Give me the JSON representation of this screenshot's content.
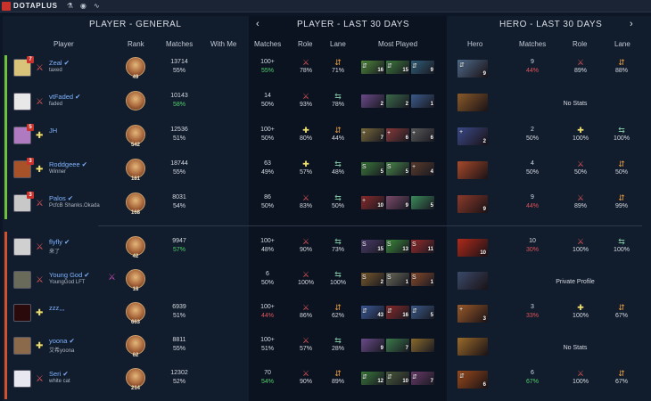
{
  "app": {
    "brand": "DOTAPLUS",
    "icons": [
      "flask-icon",
      "user-circle-icon",
      "waveform-icon"
    ]
  },
  "sections": {
    "general": "PLAYER - GENERAL",
    "last30": "PLAYER - LAST 30 DAYS",
    "hero30": "HERO - LAST 30 DAYS",
    "prev_arrow": "‹",
    "next_arrow": "›"
  },
  "headers": {
    "player": "Player",
    "rank": "Rank",
    "matches": "Matches",
    "with_me": "With Me",
    "l_matches": "Matches",
    "l_role": "Role",
    "l_lane": "Lane",
    "most_played": "Most Played",
    "hero": "Hero",
    "h_matches": "Matches",
    "h_role": "Role",
    "h_lane": "Lane"
  },
  "colors": {
    "radiant": "#6ec23b",
    "dire": "#d1502e",
    "positive": "#51d06b",
    "negative": "#e0555a"
  },
  "players": [
    {
      "name": "Zeal",
      "verified": true,
      "sub": "taxed",
      "badge": "7",
      "role_icon": "sword",
      "avatar_color": "#d9c37a",
      "rank_num": "49",
      "g_matches": "13714",
      "g_win": "55%",
      "g_win_color": "",
      "with_me": "",
      "l_matches": "100+",
      "l_win": "55%",
      "l_win_color": "green",
      "l_role_icon": "sword",
      "l_role_pct": "78%",
      "l_lane_icon": "swap",
      "l_lane_pct": "71%",
      "most": [
        {
          "role": "⇵",
          "count": "16",
          "color": "#4f8a3a"
        },
        {
          "role": "⇵",
          "count": "15",
          "color": "#3c7a3c"
        },
        {
          "role": "⇵",
          "count": "9",
          "color": "#2f5f7a"
        }
      ],
      "hero": {
        "role": "⇵",
        "count": "9",
        "color": "#4e6a8a"
      },
      "h_matches": "9",
      "h_win": "44%",
      "h_win_color": "red",
      "h_role_icon": "sword",
      "h_role_pct": "89%",
      "h_lane_icon": "swap",
      "h_lane_pct": "88%",
      "h_note": ""
    },
    {
      "name": "vtFaded",
      "verified": true,
      "sub": "faded",
      "badge": "",
      "role_icon": "sword",
      "avatar_color": "#e8e8e8",
      "rank_num": "",
      "g_matches": "10143",
      "g_win": "58%",
      "g_win_color": "green",
      "with_me": "",
      "l_matches": "14",
      "l_win": "50%",
      "l_win_color": "",
      "l_role_icon": "sword",
      "l_role_pct": "93%",
      "l_lane_icon": "lane",
      "l_lane_pct": "78%",
      "most": [
        {
          "role": "",
          "count": "2",
          "color": "#6a4a8a"
        },
        {
          "role": "",
          "count": "2",
          "color": "#3a6a4a"
        },
        {
          "role": "",
          "count": "1",
          "color": "#3a5a8a"
        }
      ],
      "hero": {
        "role": "",
        "count": "",
        "color": "#8a5a2a"
      },
      "h_matches": "",
      "h_win": "",
      "h_win_color": "",
      "h_role_icon": "",
      "h_role_pct": "",
      "h_lane_icon": "",
      "h_lane_pct": "",
      "h_note": "No Stats"
    },
    {
      "name": "JH",
      "verified": false,
      "sub": "",
      "badge": "5",
      "role_icon": "plus",
      "avatar_color": "#b07ac0",
      "rank_num": "542",
      "g_matches": "12536",
      "g_win": "51%",
      "g_win_color": "",
      "with_me": "",
      "l_matches": "100+",
      "l_win": "50%",
      "l_win_color": "",
      "l_role_icon": "plus",
      "l_role_pct": "80%",
      "l_lane_icon": "swap",
      "l_lane_pct": "44%",
      "most": [
        {
          "role": "+",
          "count": "7",
          "color": "#7a6a3a"
        },
        {
          "role": "+",
          "count": "6",
          "color": "#8a3a3a"
        },
        {
          "role": "+",
          "count": "6",
          "color": "#5a5a5a"
        }
      ],
      "hero": {
        "role": "+",
        "count": "2",
        "color": "#3a4a8a"
      },
      "h_matches": "2",
      "h_win": "50%",
      "h_win_color": "",
      "h_role_icon": "plus",
      "h_role_pct": "100%",
      "h_lane_icon": "lane",
      "h_lane_pct": "100%",
      "h_note": ""
    },
    {
      "name": "Roddgeee",
      "verified": true,
      "sub": "Winner",
      "badge": "3",
      "role_icon": "plus",
      "avatar_color": "#a8522a",
      "rank_num": "181",
      "g_matches": "18744",
      "g_win": "55%",
      "g_win_color": "",
      "with_me": "",
      "l_matches": "63",
      "l_win": "49%",
      "l_win_color": "",
      "l_role_icon": "plus",
      "l_role_pct": "57%",
      "l_lane_icon": "lane",
      "l_lane_pct": "48%",
      "most": [
        {
          "role": "S",
          "count": "5",
          "color": "#3a7a3a"
        },
        {
          "role": "S",
          "count": "5",
          "color": "#4a8a4a"
        },
        {
          "role": "+",
          "count": "4",
          "color": "#5a3a2a"
        }
      ],
      "hero": {
        "role": "",
        "count": "",
        "color": "#a84a2a"
      },
      "h_matches": "4",
      "h_win": "50%",
      "h_win_color": "",
      "h_role_icon": "sword",
      "h_role_pct": "50%",
      "h_lane_icon": "swap",
      "h_lane_pct": "50%",
      "h_note": ""
    },
    {
      "name": "Palos",
      "verified": true,
      "sub": "PcfcB Shanks.Okada",
      "badge": "3",
      "role_icon": "sword",
      "avatar_color": "#c8c8c8",
      "rank_num": "168",
      "g_matches": "8031",
      "g_win": "54%",
      "g_win_color": "",
      "with_me": "",
      "l_matches": "86",
      "l_win": "50%",
      "l_win_color": "",
      "l_role_icon": "sword",
      "l_role_pct": "83%",
      "l_lane_icon": "lane",
      "l_lane_pct": "50%",
      "most": [
        {
          "role": "+",
          "count": "10",
          "color": "#8a2a2a"
        },
        {
          "role": "",
          "count": "9",
          "color": "#7a4a6a"
        },
        {
          "role": "",
          "count": "5",
          "color": "#3a8a5a"
        }
      ],
      "hero": {
        "role": "",
        "count": "9",
        "color": "#8a3a2a"
      },
      "h_matches": "9",
      "h_win": "44%",
      "h_win_color": "red",
      "h_role_icon": "sword",
      "h_role_pct": "89%",
      "h_lane_icon": "swap",
      "h_lane_pct": "99%",
      "h_note": ""
    },
    {
      "name": "flyfly",
      "verified": true,
      "sub": "来了",
      "badge": "",
      "role_icon": "sword",
      "avatar_color": "#d0d0d0",
      "rank_num": "42",
      "g_matches": "9947",
      "g_win": "57%",
      "g_win_color": "green",
      "with_me": "",
      "l_matches": "100+",
      "l_win": "48%",
      "l_win_color": "",
      "l_role_icon": "sword",
      "l_role_pct": "90%",
      "l_lane_icon": "lane",
      "l_lane_pct": "73%",
      "most": [
        {
          "role": "S",
          "count": "15",
          "color": "#4a3a6a"
        },
        {
          "role": "S",
          "count": "13",
          "color": "#3a8a3a"
        },
        {
          "role": "S",
          "count": "11",
          "color": "#9a2a2a"
        }
      ],
      "hero": {
        "role": "",
        "count": "10",
        "color": "#b02a1a"
      },
      "h_matches": "10",
      "h_win": "30%",
      "h_win_color": "red",
      "h_role_icon": "sword",
      "h_role_pct": "100%",
      "h_lane_icon": "lane",
      "h_lane_pct": "100%",
      "h_note": ""
    },
    {
      "name": "Young God",
      "verified": true,
      "sub": "YoungGod LFT",
      "badge": "",
      "role_icon": "sword",
      "avatar_color": "#6a6a5a",
      "rank_num": "18",
      "g_matches": "",
      "g_win": "",
      "g_win_color": "",
      "with_me": "crossed-swords",
      "l_matches": "6",
      "l_win": "50%",
      "l_win_color": "",
      "l_role_icon": "sword",
      "l_role_pct": "100%",
      "l_lane_icon": "lane",
      "l_lane_pct": "100%",
      "most": [
        {
          "role": "S",
          "count": "2",
          "color": "#7a5a2a"
        },
        {
          "role": "S",
          "count": "1",
          "color": "#6a6a5a"
        },
        {
          "role": "S",
          "count": "1",
          "color": "#8a4a2a"
        }
      ],
      "hero": {
        "role": "",
        "count": "",
        "color": "#3a4a6a"
      },
      "h_matches": "",
      "h_win": "",
      "h_win_color": "",
      "h_role_icon": "",
      "h_role_pct": "",
      "h_lane_icon": "",
      "h_lane_pct": "",
      "h_note": "Private Profile"
    },
    {
      "name": "zzz,,,",
      "verified": false,
      "sub": "",
      "badge": "",
      "role_icon": "plus",
      "avatar_color": "#2a0a0a",
      "rank_num": "663",
      "g_matches": "6939",
      "g_win": "51%",
      "g_win_color": "",
      "with_me": "",
      "l_matches": "100+",
      "l_win": "44%",
      "l_win_color": "red",
      "l_role_icon": "sword",
      "l_role_pct": "86%",
      "l_lane_icon": "swap",
      "l_lane_pct": "62%",
      "most": [
        {
          "role": "⇵",
          "count": "43",
          "color": "#3a5a9a"
        },
        {
          "role": "⇵",
          "count": "16",
          "color": "#8a2a2a"
        },
        {
          "role": "⇵",
          "count": "5",
          "color": "#3a5a8a"
        }
      ],
      "hero": {
        "role": "+",
        "count": "3",
        "color": "#9a5a2a"
      },
      "h_matches": "3",
      "h_win": "33%",
      "h_win_color": "red",
      "h_role_icon": "plus",
      "h_role_pct": "100%",
      "h_lane_icon": "swap",
      "h_lane_pct": "67%",
      "h_note": ""
    },
    {
      "name": "yoona",
      "verified": true,
      "sub": "艾希yoona",
      "badge": "",
      "role_icon": "plus",
      "avatar_color": "#8a6a4a",
      "rank_num": "62",
      "g_matches": "8811",
      "g_win": "55%",
      "g_win_color": "",
      "with_me": "",
      "l_matches": "100+",
      "l_win": "51%",
      "l_win_color": "",
      "l_role_icon": "sword",
      "l_role_pct": "57%",
      "l_lane_icon": "lane",
      "l_lane_pct": "28%",
      "most": [
        {
          "role": "",
          "count": "9",
          "color": "#6a4a8a"
        },
        {
          "role": "",
          "count": "7",
          "color": "#3a7a4a"
        },
        {
          "role": "",
          "count": "",
          "color": "#8a6a2a"
        }
      ],
      "hero": {
        "role": "",
        "count": "",
        "color": "#9a6a2a"
      },
      "h_matches": "",
      "h_win": "",
      "h_win_color": "",
      "h_role_icon": "",
      "h_role_pct": "",
      "h_lane_icon": "",
      "h_lane_pct": "",
      "h_note": "No Stats"
    },
    {
      "name": "Seri",
      "verified": true,
      "sub": "white cat",
      "badge": "",
      "role_icon": "sword",
      "avatar_color": "#e8e8f0",
      "rank_num": "214",
      "g_matches": "12302",
      "g_win": "52%",
      "g_win_color": "",
      "with_me": "",
      "l_matches": "70",
      "l_win": "54%",
      "l_win_color": "green",
      "l_role_icon": "sword",
      "l_role_pct": "90%",
      "l_lane_icon": "swap",
      "l_lane_pct": "89%",
      "most": [
        {
          "role": "⇵",
          "count": "12",
          "color": "#3a7a3a"
        },
        {
          "role": "⇵",
          "count": "10",
          "color": "#4a5a3a"
        },
        {
          "role": "⇵",
          "count": "7",
          "color": "#6a3a6a"
        }
      ],
      "hero": {
        "role": "⇵",
        "count": "6",
        "color": "#9a4a1a"
      },
      "h_matches": "6",
      "h_win": "67%",
      "h_win_color": "green",
      "h_role_icon": "sword",
      "h_role_pct": "100%",
      "h_lane_icon": "swap",
      "h_lane_pct": "67%",
      "h_note": ""
    }
  ]
}
